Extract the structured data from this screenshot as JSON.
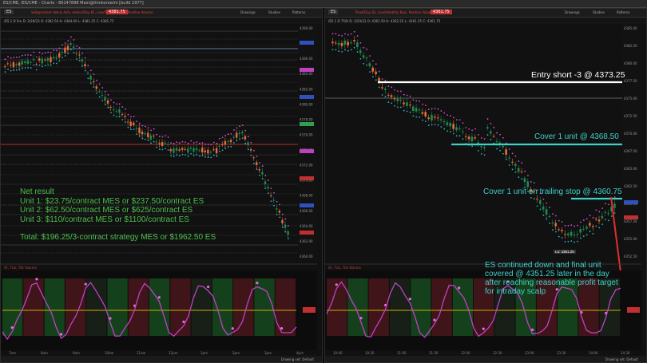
{
  "window": {
    "title": "ES/CME, /ES/CME - Charts - 86147898 Main@thinkorswim [build 1977]"
  },
  "left_chart": {
    "symbol": "ES",
    "price_badge": "4381.75",
    "studies_label": "Sell@market Heikin Ashi, Heikin/Day 81, Low/Volatility Bias, Positive Volume",
    "menu": [
      "Drawings",
      "Studies",
      "Patterns"
    ],
    "info_line": "/ES 1 D 5m  D: 3/28/23  O: 4382.50  H: 4384.00  L: 4381.25  C: 4381.75",
    "lower_study_label": "SF, Tick, Trik Volume",
    "status": "Drawing set: Default"
  },
  "right_chart": {
    "symbol": "ES",
    "price_badge": "4361.75",
    "studies_label": "Pivot/Day 81, Low/Volatility Bias, Positive Volume",
    "menu": [
      "Drawings",
      "Studies",
      "Patterns"
    ],
    "info_line": "/ES 1 D 750t  D: 3/29/23  O: 4361.50  H: 4362.25  L: 4361.25  C: 4361.75",
    "lower_study_label": "SF, Tick, Trik Volume",
    "status": "Drawing set: Default",
    "low_label": "Lo: 4351.25"
  },
  "annotations": {
    "net_result": [
      "Net result",
      "Unit 1: $23.75/contract MES or $237.50/contract ES",
      "Unit 2: $62.50/contract MES or $625/contract ES",
      "Unit 3: $110/contract MES or $1100/contract ES",
      "",
      "Total: $196.25/3-contract strategy MES or $1962.50 ES"
    ],
    "entry": "Entry short -3 @ 4373.25",
    "cover1": "Cover 1 unit @ 4368.50",
    "cover2": "Cover 1 unit on trailing stop @ 4360.75",
    "final": [
      "ES continued down and final unit",
      "covered @ 4351.25 later in the day",
      "after reaching reasonable profit target",
      "for intraday scalp"
    ]
  },
  "colors": {
    "bull": "#1f8a55",
    "bear": "#e0703c",
    "ma_pink": "#d24fd2",
    "ma_cyan": "#28b4c8",
    "annotation_green": "#4cc04c",
    "annotation_cyan": "#3fd0c8",
    "entry_white": "#ffffff",
    "arrow_red": "#e0302a"
  }
}
